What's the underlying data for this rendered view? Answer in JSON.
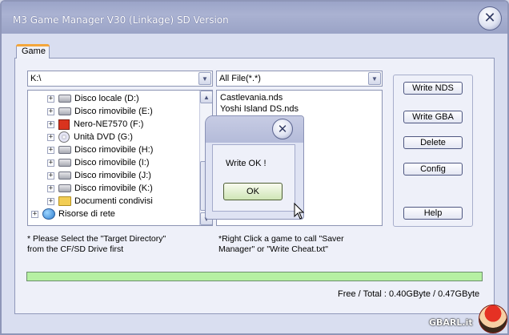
{
  "window": {
    "title": "M3 Game Manager V30 (Linkage) SD Version"
  },
  "tabs": [
    {
      "label": "Game"
    }
  ],
  "drive_combo": {
    "value": "K:\\"
  },
  "filter_combo": {
    "value": "All File(*.*)"
  },
  "tree": {
    "items": [
      {
        "label": "Disco locale (D:)",
        "icon": "drive-icon"
      },
      {
        "label": "Disco rimovibile (E:)",
        "icon": "drive-icon"
      },
      {
        "label": "Nero-NE7570 (F:)",
        "icon": "nero-icon"
      },
      {
        "label": "Unità DVD (G:)",
        "icon": "dvd-icon"
      },
      {
        "label": "Disco rimovibile (H:)",
        "icon": "drive-icon"
      },
      {
        "label": "Disco rimovibile (I:)",
        "icon": "drive-icon"
      },
      {
        "label": "Disco rimovibile (J:)",
        "icon": "drive-icon"
      },
      {
        "label": "Disco rimovibile (K:)",
        "icon": "drive-icon"
      },
      {
        "label": "Documenti condivisi",
        "icon": "folder-icon"
      },
      {
        "label": "Risorse di rete",
        "icon": "network-icon"
      }
    ]
  },
  "files": [
    "Castlevania.nds",
    "Yoshi Island DS.nds"
  ],
  "buttons": {
    "write_nds": "Write NDS",
    "write_gba": "Write GBA",
    "delete": "Delete",
    "config": "Config",
    "help": "Help"
  },
  "notes": {
    "left_line1": "* Please Select the \"Target Directory\"",
    "left_line2": "from the CF/SD Drive first",
    "right_line1": "*Right Click a game to call \"Saver",
    "right_line2": "Manager\" or \"Write Cheat.txt\""
  },
  "progress": {
    "fraction": 1.0,
    "color": "#b6f0a3"
  },
  "free_total": "Free / Total : 0.40GByte / 0.47GByte",
  "dialog": {
    "message": "Write OK !",
    "ok_label": "OK"
  },
  "watermark": "GBARL.it"
}
